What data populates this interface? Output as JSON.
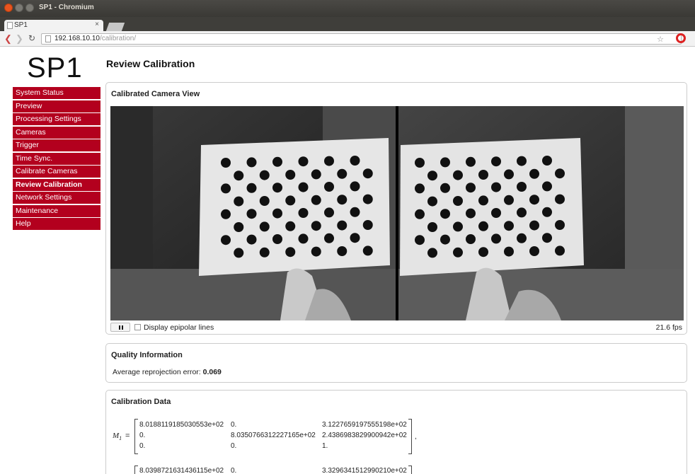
{
  "window": {
    "title": "SP1 - Chromium"
  },
  "tab": {
    "label": "SP1",
    "close": "×"
  },
  "address": {
    "host": "192.168.10.10",
    "path": "/calibration/"
  },
  "logo": "SP1",
  "menu": [
    {
      "label": "System Status"
    },
    {
      "label": "Preview"
    },
    {
      "label": "Processing Settings"
    },
    {
      "label": "Cameras"
    },
    {
      "label": "Trigger"
    },
    {
      "label": "Time Sync."
    },
    {
      "label": "Calibrate Cameras"
    },
    {
      "label": "Review Calibration"
    },
    {
      "label": "Network Settings"
    },
    {
      "label": "Maintenance"
    },
    {
      "label": "Help"
    }
  ],
  "page_title": "Review Calibration",
  "camera_panel": {
    "title": "Calibrated Camera View",
    "epipolar_label": "Display epipolar lines",
    "epipolar_checked": false,
    "fps": "21.6 fps"
  },
  "quality_panel": {
    "title": "Quality Information",
    "reproj_label": "Average reprojection error:",
    "reproj_value": "0.069"
  },
  "calib_panel": {
    "title": "Calibration Data",
    "m1_label": "M",
    "m1_sub": "1",
    "eq": "=",
    "m1": [
      [
        "8.0188119185030553e+02",
        "0.",
        "3.1227659197555198e+02"
      ],
      [
        "0.",
        "8.0350766312227165e+02",
        "2.4386983829900942e+02"
      ],
      [
        "0.",
        "0.",
        "1."
      ]
    ],
    "m1_suffix": ",",
    "m2_row0": [
      "8.0398721631436115e+02",
      "0.",
      "3.3296341512990210e+02"
    ]
  }
}
